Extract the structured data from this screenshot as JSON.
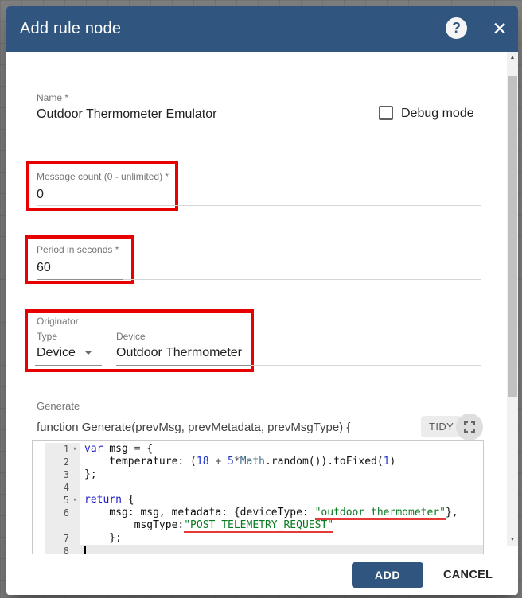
{
  "header": {
    "title": "Add rule node",
    "help_glyph": "?",
    "close_glyph": "✕"
  },
  "form": {
    "name": {
      "label": "Name *",
      "value": "Outdoor Thermometer Emulator"
    },
    "debug_mode": {
      "label": "Debug mode",
      "checked": false
    },
    "message_count": {
      "label": "Message count (0 - unlimited) *",
      "value": "0"
    },
    "period": {
      "label": "Period in seconds *",
      "value": "60"
    },
    "originator": {
      "group_label": "Originator",
      "type": {
        "label": "Type",
        "value": "Device"
      },
      "device": {
        "label": "Device",
        "value": "Outdoor Thermometer"
      }
    },
    "script": {
      "label": "Generate",
      "signature": "function Generate(prevMsg, prevMetadata, prevMsgType) {",
      "tidy_button": "TIDY"
    }
  },
  "editor": {
    "fold_glyph": "▾",
    "lines": [
      {
        "num": "1",
        "fold": true,
        "tokens": [
          [
            "kw",
            "var"
          ],
          [
            "tx",
            " msg "
          ],
          [
            "op",
            "="
          ],
          [
            "tx",
            " {"
          ]
        ]
      },
      {
        "num": "2",
        "tokens": [
          [
            "tx",
            "    temperature: ("
          ],
          [
            "num",
            "18"
          ],
          [
            "tx",
            " "
          ],
          [
            "op",
            "+"
          ],
          [
            "tx",
            " "
          ],
          [
            "num",
            "5"
          ],
          [
            "op",
            "*"
          ],
          [
            "sup",
            "Math"
          ],
          [
            "tx",
            ".random()).toFixed("
          ],
          [
            "num",
            "1"
          ],
          [
            "tx",
            ")"
          ]
        ]
      },
      {
        "num": "3",
        "tokens": [
          [
            "tx",
            "};"
          ]
        ]
      },
      {
        "num": "4",
        "tokens": []
      },
      {
        "num": "5",
        "fold": true,
        "tokens": [
          [
            "kw",
            "return"
          ],
          [
            "tx",
            " {"
          ]
        ]
      },
      {
        "num": "6",
        "tokens": [
          [
            "tx",
            "    msg: msg, metadata: {deviceType: "
          ],
          [
            "stru",
            "\"outdoor thermometer\""
          ],
          [
            "tx",
            "},"
          ]
        ]
      },
      {
        "num": "",
        "tokens": [
          [
            "tx",
            "        msgType:"
          ],
          [
            "stru",
            "\"POST_TELEMETRY_REQUEST\""
          ]
        ]
      },
      {
        "num": "7",
        "tokens": [
          [
            "tx",
            "    };"
          ]
        ]
      },
      {
        "num": "8",
        "active": true,
        "cursor": true,
        "tokens": []
      }
    ]
  },
  "scrollbar": {
    "up_glyph": "▲",
    "down_glyph": "▼"
  },
  "footer": {
    "add_label": "ADD",
    "cancel_label": "CANCEL"
  },
  "colors": {
    "primary": "#305680",
    "highlight_box": "#e60000",
    "keyword": "#1b1bc9",
    "number": "#2136c9",
    "string": "#0a7a21",
    "error_underline": "#e53935"
  }
}
